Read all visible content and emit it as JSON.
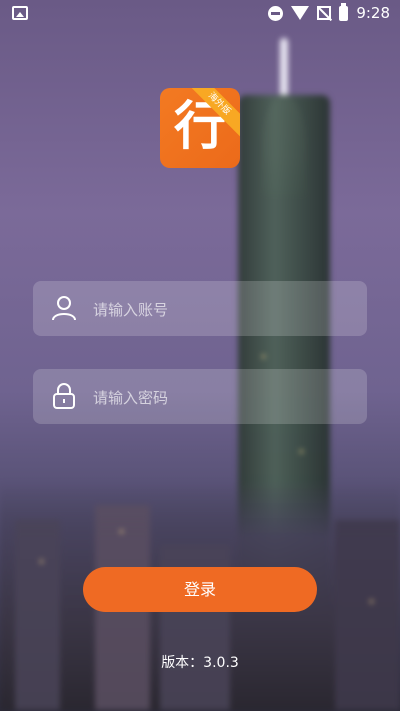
{
  "status_bar": {
    "time": "9:28",
    "icons": [
      "image-icon",
      "do-not-disturb-icon",
      "wifi-icon",
      "no-signal-icon",
      "battery-charging-icon"
    ]
  },
  "logo": {
    "char": "行",
    "badge": "海外版",
    "color": "#ef6a23"
  },
  "account": {
    "placeholder": "请输入账号",
    "value": "",
    "icon": "user-icon"
  },
  "password": {
    "placeholder": "请输入密码",
    "value": "",
    "icon": "lock-icon"
  },
  "login_button": {
    "label": "登录",
    "color": "#ef6a23"
  },
  "version": {
    "text": "版本：3.0.3"
  }
}
